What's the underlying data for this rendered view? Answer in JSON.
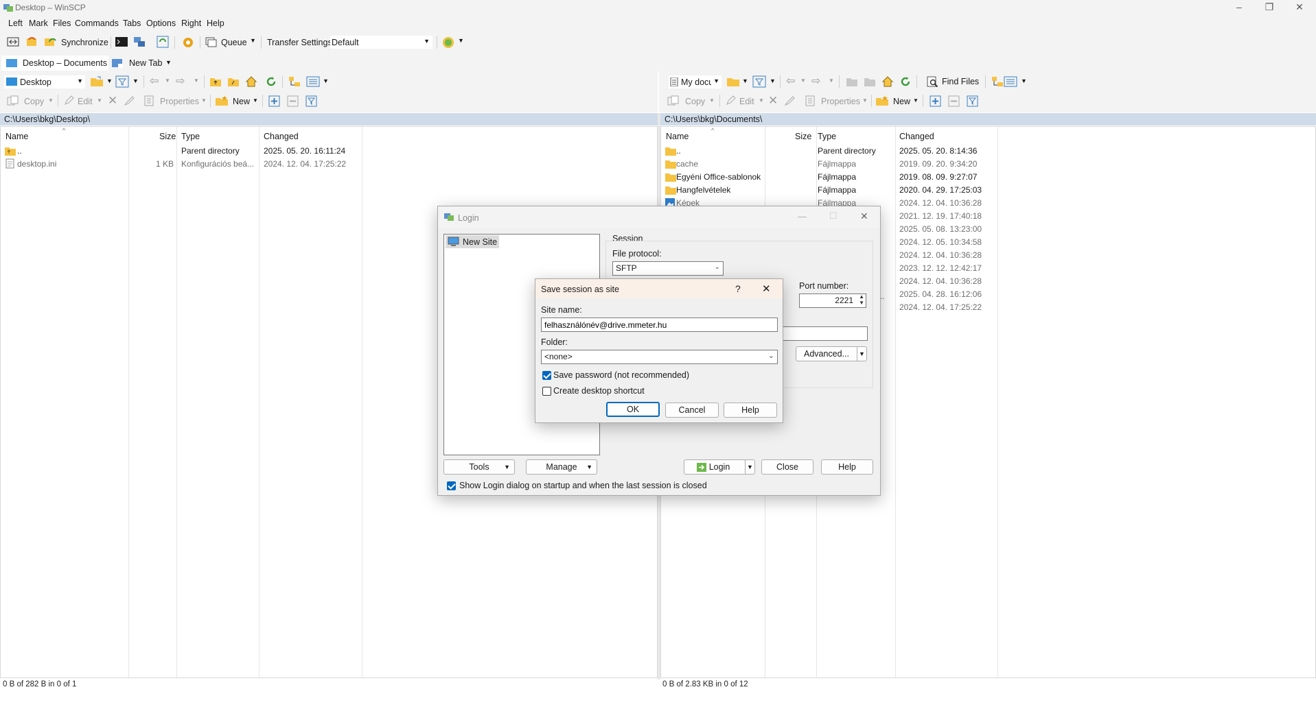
{
  "window": {
    "title": "Desktop – WinSCP"
  },
  "menu": [
    "Left",
    "Mark",
    "Files",
    "Commands",
    "Tabs",
    "Options",
    "Right",
    "Help"
  ],
  "toolbar": {
    "synchronize": "Synchronize",
    "queue": "Queue",
    "transfer_settings": "Transfer Settings",
    "transfer_preset": "Default"
  },
  "tabs": {
    "session_tab": "Desktop – Documents",
    "new_tab": "New Tab"
  },
  "left_panel": {
    "location": "Desktop",
    "actions": {
      "copy": "Copy",
      "edit": "Edit",
      "properties": "Properties",
      "new": "New"
    },
    "path": "C:\\Users\\bkg\\Desktop\\",
    "columns": [
      "Name",
      "Size",
      "Type",
      "Changed"
    ],
    "rows": [
      {
        "name": "..",
        "size": "",
        "type": "Parent directory",
        "changed": "2025. 05. 20. 16:11:24",
        "icon": "parent-folder-icon"
      },
      {
        "name": "desktop.ini",
        "size": "1 KB",
        "type": "Konfigurációs beá...",
        "changed": "2024. 12. 04. 17:25:22",
        "icon": "file-icon"
      }
    ],
    "status": "0 B of 282 B in 0 of 1"
  },
  "right_panel": {
    "location": "My docu",
    "find_files": "Find Files",
    "actions": {
      "copy": "Copy",
      "edit": "Edit",
      "properties": "Properties",
      "new": "New"
    },
    "path": "C:\\Users\\bkg\\Documents\\",
    "columns": [
      "Name",
      "Size",
      "Type",
      "Changed"
    ],
    "rows": [
      {
        "name": "..",
        "type": "Parent directory",
        "changed": "2025. 05. 20. 8:14:36"
      },
      {
        "name": "cache",
        "type": "Fájlmappa",
        "changed": "2019. 09. 20. 9:34:20"
      },
      {
        "name": "Egyéni Office-sablonok",
        "type": "Fájlmappa",
        "changed": "2019. 08. 09. 9:27:07"
      },
      {
        "name": "Hangfelvételek",
        "type": "Fájlmappa",
        "changed": "2020. 04. 29. 17:25:03"
      },
      {
        "name": "Képek",
        "type": "Fájlmappa",
        "changed": "2024. 12. 04. 10:36:28"
      }
    ],
    "hidden_changed": [
      "2021. 12. 19. 17:40:18",
      "2025. 05. 08. 13:23:00",
      "2024. 12. 05. 10:34:58",
      "2024. 12. 04. 10:36:28",
      "2023. 12. 12. 12:42:17",
      "2024. 12. 04. 10:36:28",
      "2025. 04. 28. 16:12:06",
      "2024. 12. 04. 17:25:22"
    ],
    "status": "0 B of 2.83 KB in 0 of 12"
  },
  "login_dialog": {
    "title": "Login",
    "tree_item": "New Site",
    "session_group": "Session",
    "file_protocol_label": "File protocol:",
    "file_protocol_value": "SFTP",
    "port_label": "Port number:",
    "port_value": "2221",
    "advanced": "Advanced...",
    "tools": "Tools",
    "manage": "Manage",
    "login": "Login",
    "close": "Close",
    "help": "Help",
    "show_login_checkbox": "Show Login dialog on startup and when the last session is closed"
  },
  "save_dialog": {
    "title": "Save session as site",
    "help_glyph": "?",
    "site_name_label": "Site name:",
    "site_name_value": "felhasználónév@drive.mmeter.hu",
    "folder_label": "Folder:",
    "folder_value": "<none>",
    "save_password": "Save password (not recommended)",
    "save_password_checked": true,
    "desktop_shortcut": "Create desktop shortcut",
    "desktop_shortcut_checked": false,
    "ok": "OK",
    "cancel": "Cancel",
    "help": "Help"
  },
  "colors": {
    "accent": "#0067c0",
    "pathbar": "#cfdbe8",
    "folder": "#f5c242"
  }
}
